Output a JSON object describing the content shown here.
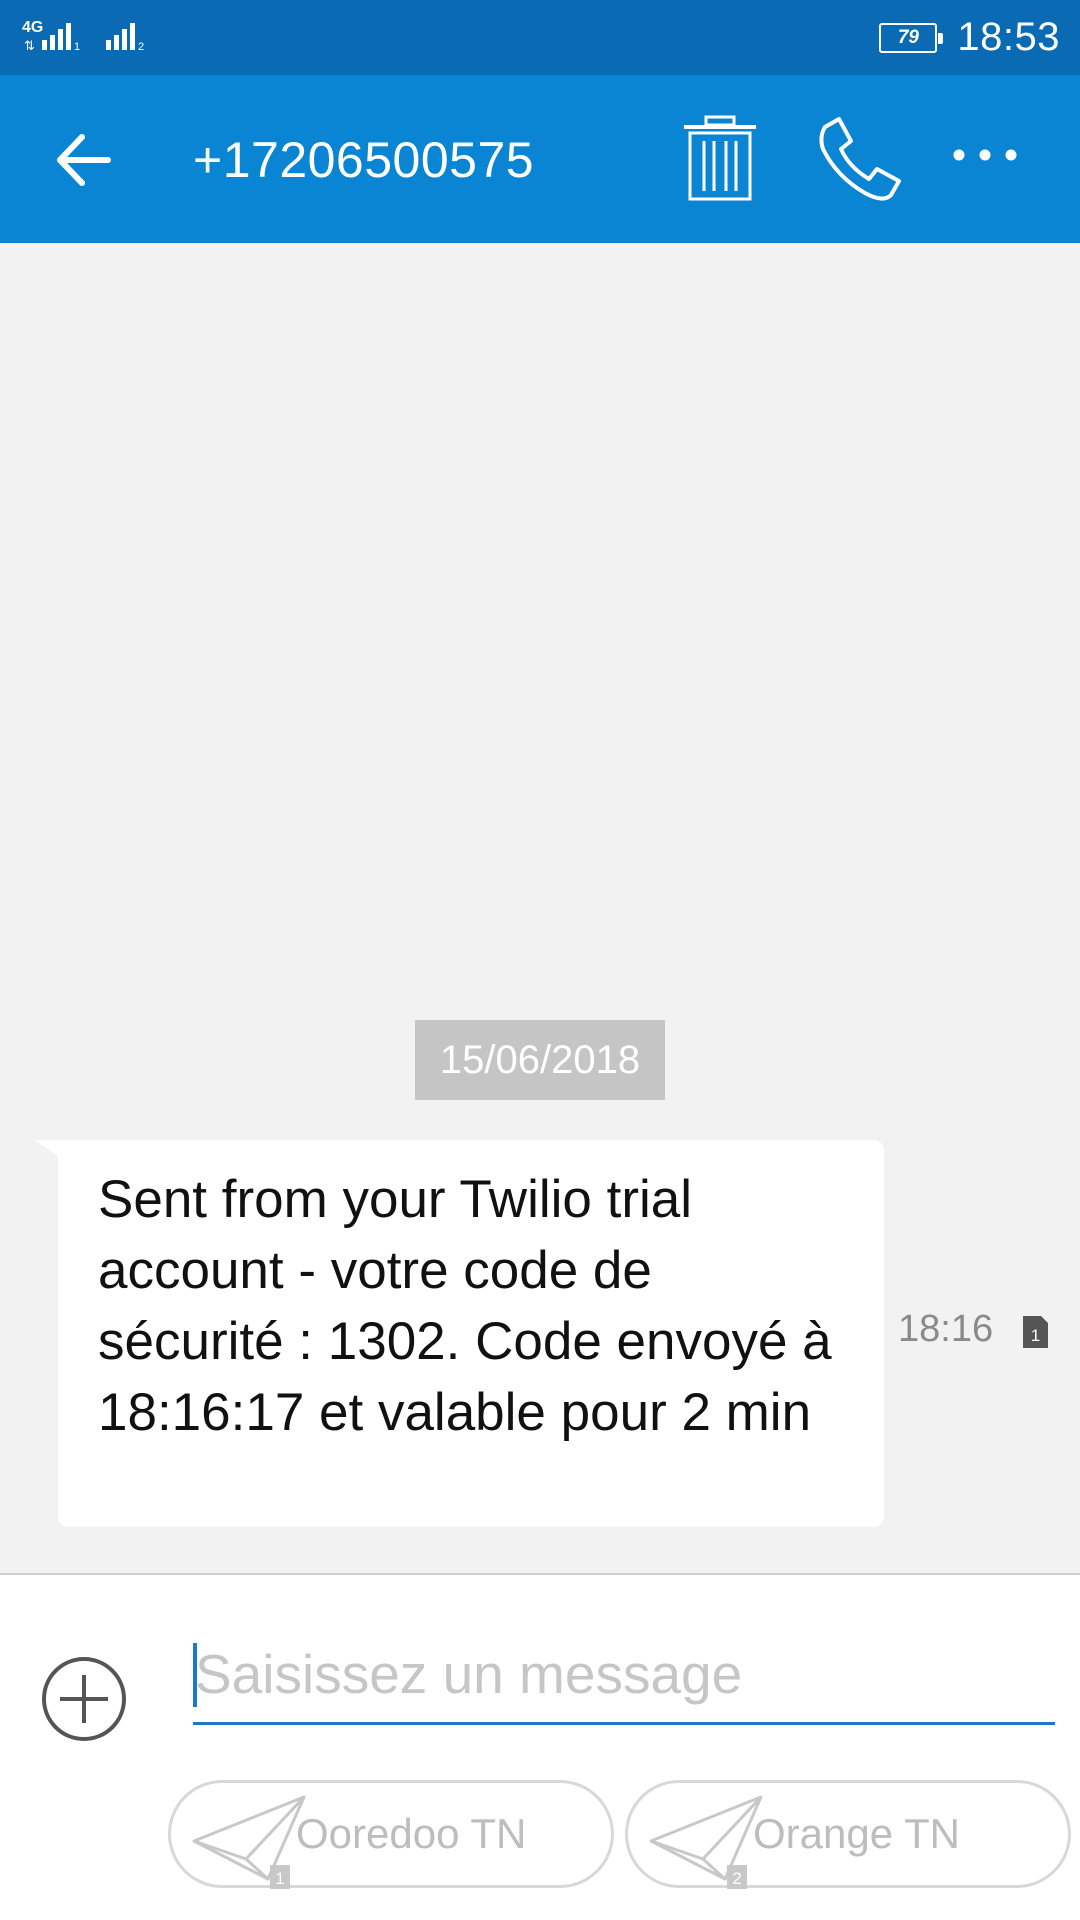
{
  "status_bar": {
    "network_type": "4G",
    "sim1_index": "1",
    "sim2_index": "2",
    "battery_level": "79",
    "clock": "18:53"
  },
  "app_bar": {
    "title": "+17206500575",
    "icons": [
      "back-arrow-icon",
      "trash-icon",
      "phone-icon",
      "more-icon"
    ]
  },
  "conversation": {
    "date_separator": "15/06/2018",
    "messages": [
      {
        "text": "Sent from your Twilio trial account - votre code de sécurité : 1302. Code envoyé à 18:16:17 et valable pour 2 min",
        "time": "18:16",
        "sim_index": "1"
      }
    ]
  },
  "composer": {
    "placeholder": "Saisissez un message",
    "value": "",
    "send_sim1": {
      "label": "Ooredoo TN",
      "index": "1"
    },
    "send_sim2": {
      "label": "Orange TN",
      "index": "2"
    }
  },
  "colors": {
    "status_bar": "#0a6bb4",
    "app_bar": "#0a85d4",
    "accent": "#1a7ac9",
    "background": "#f2f2f2"
  }
}
